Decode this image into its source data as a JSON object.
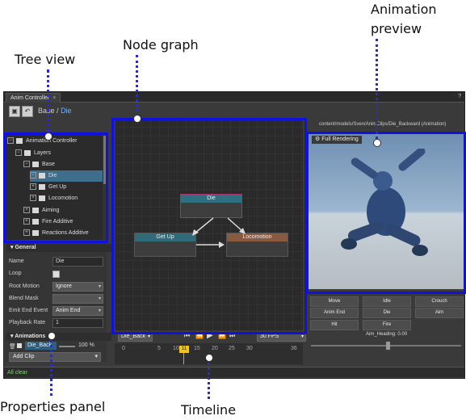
{
  "callouts": {
    "animation_preview": "Animation\npreview",
    "node_graph": "Node graph",
    "tree_view": "Tree view",
    "properties_panel": "Properties panel",
    "timeline": "Timeline"
  },
  "window": {
    "tab_title": "Anim Controller",
    "tab_close": "×",
    "help": "?"
  },
  "breadcrumb": {
    "base": "Base",
    "separator": "/",
    "current": "Die"
  },
  "tree": {
    "items": [
      {
        "label": "Animation Controller"
      },
      {
        "label": "Layers"
      },
      {
        "label": "Base"
      },
      {
        "label": "Die"
      },
      {
        "label": "Get Up"
      },
      {
        "label": "Locomotion"
      },
      {
        "label": "Aiming"
      },
      {
        "label": "Fire Additive"
      },
      {
        "label": "Reactions Additive"
      }
    ]
  },
  "properties": {
    "general_title": "General",
    "name_label": "Name",
    "name_value": "Die",
    "loop_label": "Loop",
    "root_motion_label": "Root Motion",
    "root_motion_value": "Ignore",
    "blend_mask_label": "Blend Mask",
    "blend_mask_value": "",
    "emit_end_label": "Emit End Event",
    "emit_end_value": "Anim End",
    "playback_rate_label": "Playback Rate",
    "playback_rate_value": "1",
    "animations_title": "Animations",
    "clip_name": "Die_Back",
    "clip_percent": "100 %",
    "add_clip": "Add Clip"
  },
  "graph": {
    "nodes": [
      {
        "label": "Die",
        "color": "#2f7080",
        "border": "#b0306a"
      },
      {
        "label": "Get Up",
        "color": "#2f6b78",
        "border": "#555555"
      },
      {
        "label": "Locomotion",
        "color": "#8a5a40",
        "border": "#555555"
      }
    ]
  },
  "timeline": {
    "clip_select": "Die_Back",
    "fps_select": "30 FPS",
    "start": "0",
    "end": "36",
    "ticks": [
      "5",
      "10",
      "15",
      "20",
      "25",
      "30"
    ],
    "current_frame": "11"
  },
  "preview": {
    "path": "content/models/Sven/AnimClips/Die_Backward (Animation)",
    "full_rendering": "Full Rendering",
    "buttons": [
      "Move",
      "Idle",
      "Crouch",
      "Anim End",
      "Die",
      "Aim",
      "Hit",
      "Fire"
    ],
    "slider_label": "Aim_Heading: 0.00"
  },
  "status": {
    "text": "All clear"
  },
  "colors": {
    "highlight": "#1010e0",
    "accent": "#6fb7ff",
    "selection": "#3e6e8c"
  }
}
